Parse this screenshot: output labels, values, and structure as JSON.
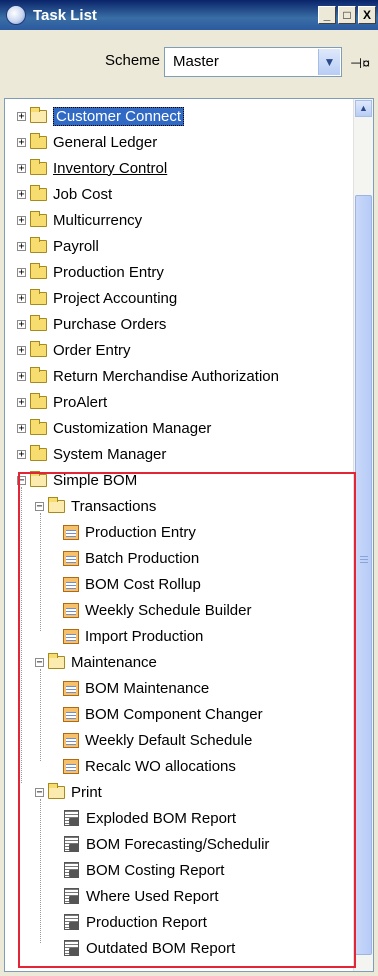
{
  "window": {
    "title": "Task List",
    "minimize": "_",
    "maximize": "□",
    "close": "X"
  },
  "scheme": {
    "label": "Scheme",
    "value": "Master"
  },
  "tree": {
    "modules": [
      "Customer Connect",
      "General Ledger",
      "Inventory Control",
      "Job Cost",
      "Multicurrency",
      "Payroll",
      "Production Entry",
      "Project Accounting",
      "Purchase Orders",
      "Order Entry",
      "Return Merchandise Authorization",
      "ProAlert",
      "Customization Manager",
      "System Manager"
    ],
    "simple_bom": {
      "label": "Simple BOM",
      "transactions": {
        "label": "Transactions",
        "items": [
          "Production Entry",
          "Batch Production",
          "BOM Cost Rollup",
          "Weekly Schedule Builder",
          "Import Production"
        ]
      },
      "maintenance": {
        "label": "Maintenance",
        "items": [
          "BOM Maintenance",
          "BOM Component Changer",
          "Weekly Default Schedule",
          "Recalc WO allocations"
        ]
      },
      "print": {
        "label": "Print",
        "items": [
          "Exploded BOM Report",
          "BOM Forecasting/Schedulir",
          "BOM Costing Report",
          "Where Used Report",
          "Production Report",
          "Outdated BOM Report"
        ]
      }
    }
  },
  "colors": {
    "selection": "#316ac5",
    "highlight_border": "#e32636",
    "folder": "#f7dc6f"
  }
}
